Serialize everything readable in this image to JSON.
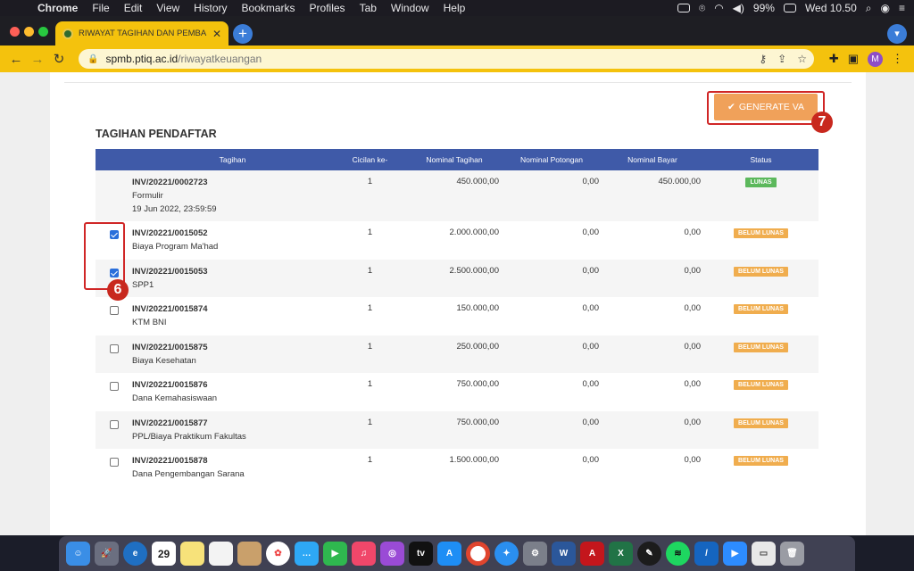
{
  "menubar": {
    "items": [
      "Chrome",
      "File",
      "Edit",
      "View",
      "History",
      "Bookmarks",
      "Profiles",
      "Tab",
      "Window",
      "Help"
    ],
    "battery": "99%",
    "clock": "Wed 10.50"
  },
  "browser": {
    "tab_title": "RIWAYAT TAGIHAN DAN PEMBA",
    "url_domain": "spmb.ptiq.ac.id",
    "url_path": "/riwayatkeuangan",
    "profile_initial": "M",
    "accent": "#f4c20d"
  },
  "page": {
    "generate_label": "GENERATE VA",
    "section_title": "TAGIHAN PENDAFTAR",
    "annotation_6": "6",
    "annotation_7": "7",
    "columns": [
      "Tagihan",
      "Cicilan ke-",
      "Nominal Tagihan",
      "Nominal Potongan",
      "Nominal Bayar",
      "Status"
    ],
    "rows": [
      {
        "inv": "INV/20221/0002723",
        "name": "Formulir",
        "date": "19 Jun 2022, 23:59:59",
        "cicilan": "1",
        "tagihan": "450.000,00",
        "potongan": "0,00",
        "bayar": "450.000,00",
        "status": "LUNAS"
      },
      {
        "inv": "INV/20221/0015052",
        "name": "Biaya Program Ma'had",
        "date": "",
        "cicilan": "1",
        "tagihan": "2.000.000,00",
        "potongan": "0,00",
        "bayar": "0,00",
        "status": "BELUM LUNAS"
      },
      {
        "inv": "INV/20221/0015053",
        "name": "SPP1",
        "date": "",
        "cicilan": "1",
        "tagihan": "2.500.000,00",
        "potongan": "0,00",
        "bayar": "0,00",
        "status": "BELUM LUNAS"
      },
      {
        "inv": "INV/20221/0015874",
        "name": "KTM BNI",
        "date": "",
        "cicilan": "1",
        "tagihan": "150.000,00",
        "potongan": "0,00",
        "bayar": "0,00",
        "status": "BELUM LUNAS"
      },
      {
        "inv": "INV/20221/0015875",
        "name": "Biaya Kesehatan",
        "date": "",
        "cicilan": "1",
        "tagihan": "250.000,00",
        "potongan": "0,00",
        "bayar": "0,00",
        "status": "BELUM LUNAS"
      },
      {
        "inv": "INV/20221/0015876",
        "name": "Dana Kemahasiswaan",
        "date": "",
        "cicilan": "1",
        "tagihan": "750.000,00",
        "potongan": "0,00",
        "bayar": "0,00",
        "status": "BELUM LUNAS"
      },
      {
        "inv": "INV/20221/0015877",
        "name": "PPL/Biaya Praktikum Fakultas",
        "date": "",
        "cicilan": "1",
        "tagihan": "750.000,00",
        "potongan": "0,00",
        "bayar": "0,00",
        "status": "BELUM LUNAS"
      },
      {
        "inv": "INV/20221/0015878",
        "name": "Dana Pengembangan Sarana",
        "date": "",
        "cicilan": "1",
        "tagihan": "1.500.000,00",
        "potongan": "0,00",
        "bayar": "0,00",
        "status": "BELUM LUNAS"
      }
    ],
    "checkboxes": [
      "none",
      "checked",
      "checked",
      "unchecked",
      "unchecked",
      "unchecked",
      "unchecked",
      "unchecked"
    ]
  },
  "dock": {
    "calendar_day": "29",
    "apps": [
      "finder-icon",
      "launchpad-icon",
      "edge-icon",
      "calendar-icon",
      "notes-icon",
      "reminders-icon",
      "photos-icon",
      "messages-icon",
      "facetime-icon",
      "music-icon",
      "podcasts-icon",
      "appletv-icon",
      "appstore-icon",
      "chrome-icon",
      "safari-icon",
      "settings-icon",
      "word-icon",
      "acrobat-icon",
      "excel-icon",
      "inkscape-icon",
      "spotify-icon",
      "vscode-icon",
      "zoom-icon",
      "preview-icon",
      "trash-icon"
    ]
  }
}
